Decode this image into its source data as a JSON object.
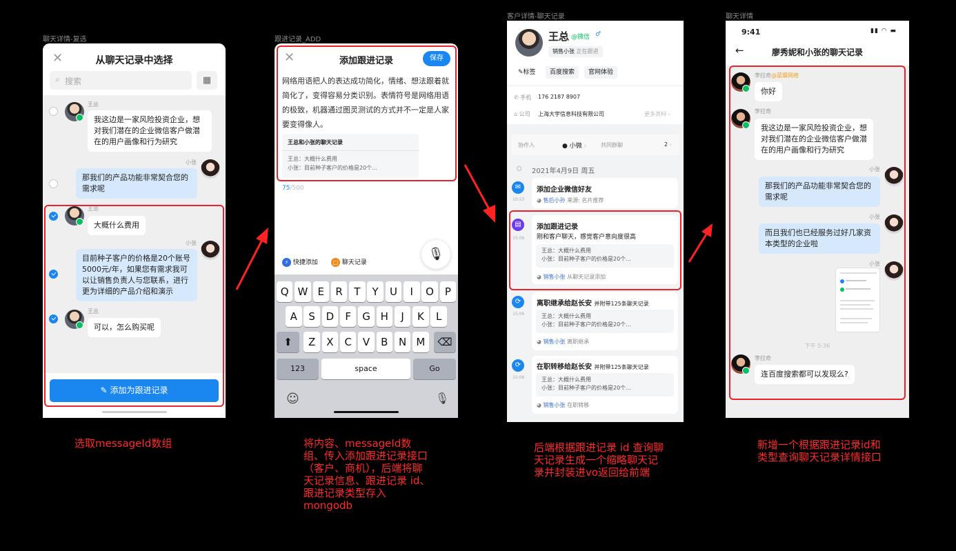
{
  "frames": {
    "f1": "聊天详情-复选",
    "f2": "跟进记录_ADD",
    "f3": "客户详情-聊天记录",
    "f4": "聊天详情"
  },
  "s1": {
    "title": "从聊天记录中选择",
    "search_placeholder": "搜索",
    "msgs": [
      {
        "name": "王总",
        "text": "我这边是一家风险投资企业，想对我们潜在的企业微信客户做潜在的用户画像和行为研究"
      },
      {
        "name": "小张",
        "text": "那我们的产品功能非常契合您的需求呢"
      },
      {
        "name": "王总",
        "text": "大概什么费用"
      },
      {
        "name": "小张",
        "text": "目前种子客户的价格是20个账号5000元/年，如果您有需求我可以让销售负责人与您联系，进行更为详细的产品介绍和演示"
      },
      {
        "name": "王总",
        "text": "可以，怎么购买呢"
      }
    ],
    "button": "添加为跟进记录"
  },
  "s2": {
    "title": "添加跟进记录",
    "save": "保存",
    "body": "网络用语把人的表达成功简化，情绪、想法跟着就简化了，变得容易分类识别。表情符号是网络用语的极致，机器通过图灵测试的方式并不一定是人家要变得像人。",
    "card_title": "王总和小张的聊天记录",
    "card_line1": "王总：大概什么费用",
    "card_line2": "小张：目前种子客户的价格是20个...",
    "count": "75",
    "count_max": "/500",
    "quick_add": "快捷添加",
    "chat_record": "聊天记录",
    "rows": [
      [
        "Q",
        "W",
        "E",
        "R",
        "T",
        "Y",
        "U",
        "I",
        "O",
        "P"
      ],
      [
        "A",
        "S",
        "D",
        "F",
        "G",
        "H",
        "J",
        "K",
        "L"
      ],
      [
        "Z",
        "X",
        "C",
        "V",
        "B",
        "N",
        "M"
      ]
    ],
    "key_123": "123",
    "key_space": "space",
    "key_go": "Go"
  },
  "s3": {
    "name": "王总",
    "wx_tag": "@微信",
    "owner": "销售小张",
    "owner_status": "正在跟进",
    "tags": [
      "标签",
      "百度搜索",
      "官网体验"
    ],
    "phone_label": "手机",
    "phone": "176 2187 8907",
    "company_label": "公司",
    "company": "上海大宇信息科技有限公司",
    "more": "更多资料",
    "collab_label": "协作人",
    "collab_name": "小微",
    "group_label": "共同群聊",
    "group_count": "2",
    "date": "2021年4月9日 周五",
    "items": [
      {
        "time": "10:53",
        "title": "添加企业微信好友",
        "meta_user": "售后小孙",
        "meta_text": "来源: 名片推荐"
      },
      {
        "time": "15:06",
        "title": "添加跟进记录",
        "desc": "刚和客户聊天，感觉客户意向度很高",
        "line1": "王总：大概什么费用",
        "line2": "小张：目前种子客户的价格是20个...",
        "meta_user": "销售小张",
        "meta_text": "从聊天记录添加"
      },
      {
        "time": "15:06",
        "title": "离职继承给赵长安",
        "extra": "并附带125条聊天记录",
        "line1": "王总：大概什么费用",
        "line2": "小张：目前种子客户的价格是20个...",
        "meta_user": "销售小张",
        "meta_text": "离职继承"
      },
      {
        "time": "15:06",
        "title": "在职转移给赵长安",
        "extra": "并附带125条聊天记录",
        "line1": "王总：大概什么费用",
        "line2": "小张：目前种子客户的价格是20个...",
        "meta_user": "销售小张",
        "meta_text": "在职转移"
      }
    ]
  },
  "s4": {
    "status_time": "9:41",
    "title": "廖秀妮和小张的聊天记录",
    "sender1": "李拉奇",
    "sender1_tag": "@蓝猬网络",
    "msgs": [
      {
        "name": "李拉奇",
        "text": "你好"
      },
      {
        "name": "李拉奇",
        "text": "我这边是一家风险投资企业，想对我们潜在的企业微信客户做潜在的用户画像和行为研究"
      },
      {
        "name": "小张",
        "text": "那我们的产品功能非常契合您的需求呢"
      },
      {
        "name": "小张",
        "text": "而且我们也已经服务过好几家资本类型的企业啦"
      },
      {
        "name": "小张",
        "text": ""
      },
      {
        "name": "李拉奇",
        "text": "连百度搜索都可以发现么?"
      }
    ],
    "time_sep": "下午 5:36"
  },
  "captions": {
    "c1": "选取messageId数组",
    "c2": "将内容、messageId数组、传入添加跟进记录接口（客户、商机），后端将聊天记录信息、跟进记录 id、跟进记录类型存入mongodb",
    "c3": "后端根据跟进记录 id 查询聊天记录生成一个缩略聊天记录并封装进vo返回给前端",
    "c4": "新增一个根据跟进记录id和类型查询聊天记录详情接口"
  },
  "colors": {
    "accent": "#1a86f0",
    "highlight": "#e8222a",
    "caption": "#ff2a2a"
  }
}
